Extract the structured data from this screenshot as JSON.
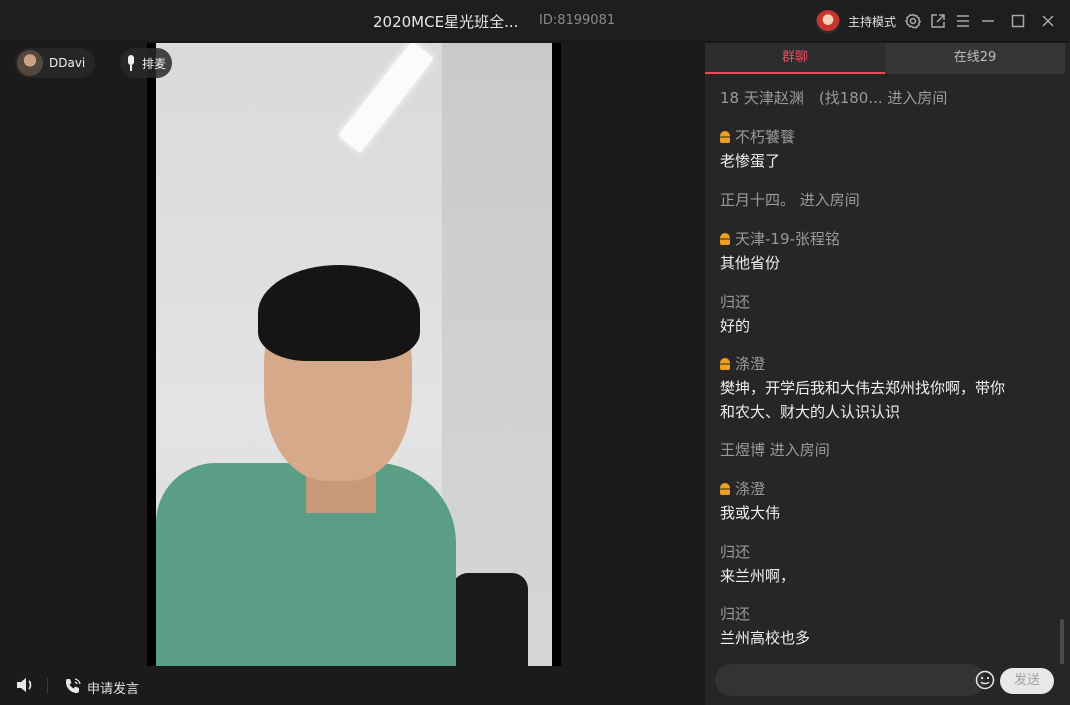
{
  "window": {
    "title": "2020MCE星光班全...",
    "room_id": "ID:8199081",
    "host_mode_label": "主持模式",
    "icons": [
      "settings-icon",
      "share-icon",
      "menu-icon",
      "minimize-icon",
      "maximize-icon",
      "close-icon"
    ]
  },
  "stage": {
    "presenter_name": "DDavi",
    "mic_queue_label": "排麦",
    "apply_speak_label": "申请发言"
  },
  "panel": {
    "tabs": [
      {
        "label": "群聊",
        "active": true
      },
      {
        "label": "在线29",
        "active": false
      }
    ],
    "messages": [
      {
        "type": "system",
        "text": "18 天津赵渊　(找180... 进入房间"
      },
      {
        "type": "chat",
        "name": "不朽饕餮",
        "badge": true,
        "text": "老惨蛋了"
      },
      {
        "type": "system",
        "text": "正月十四。 进入房间"
      },
      {
        "type": "chat",
        "name": "天津-19-张程铭",
        "badge": true,
        "text": "其他省份"
      },
      {
        "type": "chat",
        "name": "归还",
        "badge": false,
        "text": "好的"
      },
      {
        "type": "chat",
        "name": "涤澄",
        "badge": true,
        "text": "樊坤，开学后我和大伟去郑州找你啊，带你",
        "text2": "和农大、财大的人认识认识"
      },
      {
        "type": "system",
        "text": "王煜博 进入房间"
      },
      {
        "type": "chat",
        "name": "涤澄",
        "badge": true,
        "text": "我或大伟"
      },
      {
        "type": "chat",
        "name": "归还",
        "badge": false,
        "text": "来兰州啊，"
      },
      {
        "type": "chat",
        "name": "归还",
        "badge": false,
        "text": "兰州高校也多"
      }
    ],
    "send_label": "发送",
    "input_value": ""
  },
  "colors": {
    "accent": "#ea4c5e",
    "badge": "#f0a020",
    "background": "#1b1b1b",
    "panel": "#262626"
  }
}
